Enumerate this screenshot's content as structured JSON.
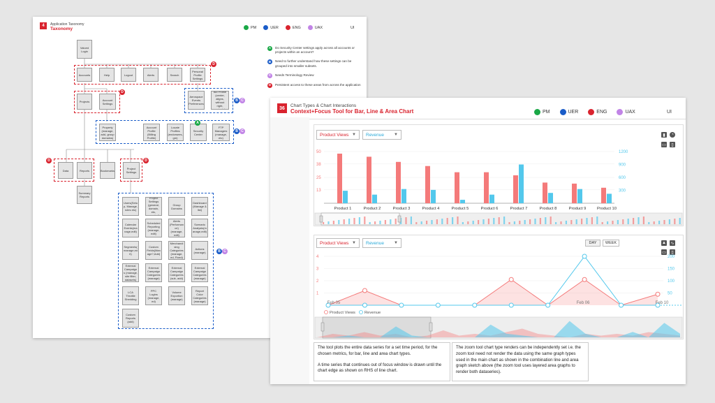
{
  "colors": {
    "accent": "#d9232e",
    "pm": "#1aa847",
    "uer": "#1a5cc8",
    "eng": "#d9232e",
    "uax": "#c184e6",
    "bar_red": "#f47a7a",
    "bar_blue": "#53c8ec"
  },
  "legend": {
    "pm": "PM",
    "uer": "UER",
    "eng": "ENG",
    "uax": "UAX",
    "ui": "UI"
  },
  "sheet1": {
    "badge": "4",
    "subtitle": "Application Taxonomy",
    "title": "Taxonomy",
    "nodes": {
      "login": "Valued Login",
      "accounts": "Accounts",
      "help": "Help",
      "logout": "Logout",
      "alerts": "Alerts",
      "search": "Search",
      "personal": "Personal Profile Settings",
      "projects": "Projects",
      "account_settings": "Account Settings",
      "aerospace": "Aerospace Events Preferences",
      "bio": "Bio Profile (center, aligns, without right, projects)",
      "property": "Property (manage, add, group domains)",
      "account_profile": "Account Profile (Billing Profile)",
      "locate": "Locate Profiles (endorsees, gm)",
      "security": "Security Center",
      "ftp": "FTP Managers (manage, etc)",
      "data": "Data",
      "reports": "Reports",
      "bookmarks": "Bookmarks",
      "project_settings": "Project Settings",
      "summary": "Summary Reports",
      "users": "Users(Setu p, Manage, roles etc)",
      "proj_settings_general": "Project Settings (general, domain, etc, exported)",
      "group_domains": "Group Domains",
      "dashboard": "Dashboard (Manage & list)",
      "calendar": "Calendar Events(ma nage,edit)",
      "scheduled": "Scheduled Reporting (manage, edit)",
      "alerts_perf": "Alerts (Performan ce) (manage, edit)",
      "scenario": "Scenario Analysis(m anage,edit)",
      "segments": "Segments( manage,ed it)",
      "custom": "Custom Fields(Man age?,Add)",
      "merchandising": "Merchandi sing Categories (manage, ed, Fixed)",
      "actions": "Actions (manage)",
      "external": "External Campaign s (manage, site filter, datasets)",
      "ext_camp_a": "External Campaign Categories (manage)",
      "ext_camp_b": "External Campaign Categories (sub, add)",
      "ext_camp_c": "External Campaign Categories (manage)",
      "lca": "LCA Throttle Shedding",
      "ppc": "PPC Logins (manage, ed)",
      "volume": "Volume Exportion (manage)",
      "report_cats": "Report Color Categories (manage)",
      "custom_reports": "Custom Reports (add)"
    },
    "markers": {
      "a": "A",
      "b": "B",
      "c": "C",
      "d": "D"
    },
    "notes": [
      {
        "marker": "A",
        "text": "Do Security Center settings apply across all accounts or projects within an account?"
      },
      {
        "marker": "B",
        "text": "Need to further understand how these settings can be grouped into smaller subsets."
      },
      {
        "marker": "C",
        "text": "Needs Terminology Review"
      },
      {
        "marker": "D",
        "text": "Persistent access to these areas from across the application"
      }
    ]
  },
  "sheet2": {
    "badge": "36",
    "subtitle": "Chart Types & Chart Interactions",
    "title": "Context+Focus Tool for Bar, Line & Area Chart",
    "dropdown_a": "Product Views",
    "dropdown_b": "Revenue",
    "day_label": "DAY",
    "week_label": "WEEK",
    "legend_a": "Product Views",
    "legend_b": "Revenue",
    "desc_left": [
      "The tool plots the entire data series for a set time period, for the chosen metrics, for bar, line and area chart types.",
      "A time series that continues out of focus window is drawn until the chart edge as shown on RHS of line chart."
    ],
    "desc_right": "The zoom tool chart type renders can be independently set i.e. the zoom tool need not render the data using the same graph types used in the main chart as shown in the combination line and area graph sketch above (the zoom tool uses layered area graphs to render both dataseries)."
  },
  "chart_data": [
    {
      "type": "bar",
      "categories": [
        "Product 1",
        "Product 2",
        "Product 3",
        "Product 4",
        "Product 5",
        "Product 6",
        "Product 7",
        "Product 8",
        "Product 9",
        "Product 10"
      ],
      "series": [
        {
          "name": "Product Views",
          "values": [
            48,
            45,
            40,
            36,
            30,
            30,
            27,
            20,
            19,
            15
          ]
        },
        {
          "name": "Revenue",
          "values": [
            290,
            200,
            330,
            310,
            80,
            200,
            900,
            240,
            330,
            220
          ]
        }
      ],
      "y_left_ticks": [
        "13",
        "25",
        "38",
        "50"
      ],
      "y_right_ticks": [
        "300",
        "600",
        "900",
        "1200"
      ],
      "ylim_left": [
        0,
        50
      ],
      "ylim_right": [
        0,
        1200
      ]
    },
    {
      "type": "line",
      "x_ticks": [
        "Feb 05",
        "Feb 06",
        "Feb 10"
      ],
      "series": [
        {
          "name": "Product Views",
          "values": [
            0,
            1.2,
            0,
            0,
            0,
            2.1,
            0,
            2.1,
            0,
            0.9
          ]
        },
        {
          "name": "Revenue",
          "values": [
            0,
            0,
            0,
            0,
            0,
            0,
            0,
            200,
            0,
            0
          ]
        }
      ],
      "y_left_ticks": [
        "1",
        "2",
        "3",
        "4"
      ],
      "y_right_ticks": [
        "50",
        "100",
        "150",
        "200"
      ],
      "ylim_left": [
        0,
        4
      ],
      "ylim_right": [
        0,
        200
      ]
    }
  ]
}
